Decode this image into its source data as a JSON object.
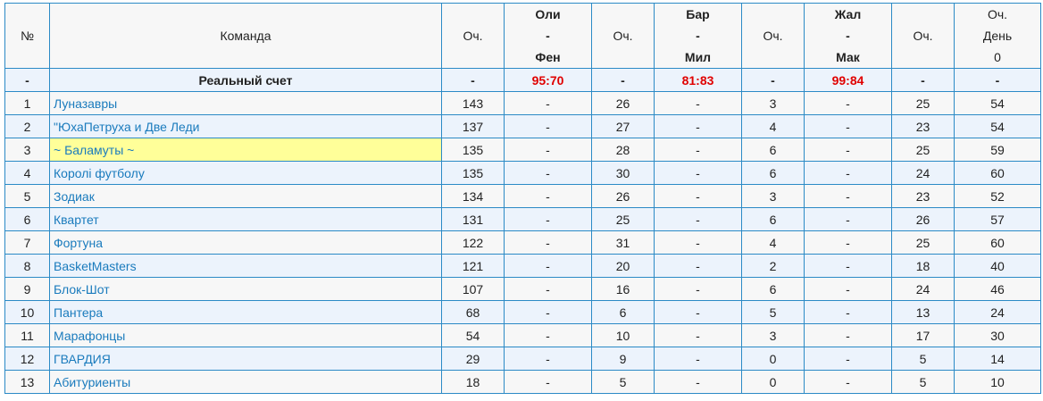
{
  "header": {
    "num": "№",
    "team": "Команда",
    "points": "Оч.",
    "matches": [
      {
        "home": "Оли",
        "sep": "-",
        "away": "Фен"
      },
      {
        "home": "Бар",
        "sep": "-",
        "away": "Мил"
      },
      {
        "home": "Жал",
        "sep": "-",
        "away": "Мак"
      }
    ],
    "day": {
      "l1": "Оч.",
      "l2": "День",
      "l3": "0"
    }
  },
  "real_row": {
    "num": "-",
    "label": "Реальный счет",
    "total": "-",
    "m1": "95:70",
    "p1": "-",
    "m2": "81:83",
    "p2": "-",
    "m3": "99:84",
    "p3": "-",
    "day": "-"
  },
  "rows": [
    {
      "num": "1",
      "team": "Луназавры",
      "total": "143",
      "m1": "-",
      "p1": "26",
      "m2": "-",
      "p2": "3",
      "m3": "-",
      "p3": "25",
      "day": "54"
    },
    {
      "num": "2",
      "team": "\"ЮхаПетруха и Две Леди",
      "total": "137",
      "m1": "-",
      "p1": "27",
      "m2": "-",
      "p2": "4",
      "m3": "-",
      "p3": "23",
      "day": "54"
    },
    {
      "num": "3",
      "team": "~ Баламуты ~",
      "total": "135",
      "m1": "-",
      "p1": "28",
      "m2": "-",
      "p2": "6",
      "m3": "-",
      "p3": "25",
      "day": "59"
    },
    {
      "num": "4",
      "team": "Королі футболу",
      "total": "135",
      "m1": "-",
      "p1": "30",
      "m2": "-",
      "p2": "6",
      "m3": "-",
      "p3": "24",
      "day": "60"
    },
    {
      "num": "5",
      "team": "Зодиак",
      "total": "134",
      "m1": "-",
      "p1": "26",
      "m2": "-",
      "p2": "3",
      "m3": "-",
      "p3": "23",
      "day": "52"
    },
    {
      "num": "6",
      "team": "Квартет",
      "total": "131",
      "m1": "-",
      "p1": "25",
      "m2": "-",
      "p2": "6",
      "m3": "-",
      "p3": "26",
      "day": "57"
    },
    {
      "num": "7",
      "team": "Фортуна",
      "total": "122",
      "m1": "-",
      "p1": "31",
      "m2": "-",
      "p2": "4",
      "m3": "-",
      "p3": "25",
      "day": "60"
    },
    {
      "num": "8",
      "team": "BasketMasters",
      "total": "121",
      "m1": "-",
      "p1": "20",
      "m2": "-",
      "p2": "2",
      "m3": "-",
      "p3": "18",
      "day": "40"
    },
    {
      "num": "9",
      "team": "Блок-Шот",
      "total": "107",
      "m1": "-",
      "p1": "16",
      "m2": "-",
      "p2": "6",
      "m3": "-",
      "p3": "24",
      "day": "46"
    },
    {
      "num": "10",
      "team": "Пантера",
      "total": "68",
      "m1": "-",
      "p1": "6",
      "m2": "-",
      "p2": "5",
      "m3": "-",
      "p3": "13",
      "day": "24"
    },
    {
      "num": "11",
      "team": "Марафонцы",
      "total": "54",
      "m1": "-",
      "p1": "10",
      "m2": "-",
      "p2": "3",
      "m3": "-",
      "p3": "17",
      "day": "30"
    },
    {
      "num": "12",
      "team": "ГВАРДИЯ",
      "total": "29",
      "m1": "-",
      "p1": "9",
      "m2": "-",
      "p2": "0",
      "m3": "-",
      "p3": "5",
      "day": "14"
    },
    {
      "num": "13",
      "team": "Абитуриенты",
      "total": "18",
      "m1": "-",
      "p1": "5",
      "m2": "-",
      "p2": "0",
      "m3": "-",
      "p3": "5",
      "day": "10"
    }
  ],
  "highlighted_row": 2,
  "colors": {
    "border": "#2b8ac6",
    "team_link": "#1a7bbd",
    "score_red": "#e00000",
    "highlight": "#ffff99",
    "row_alt": "#ecf3fc"
  }
}
